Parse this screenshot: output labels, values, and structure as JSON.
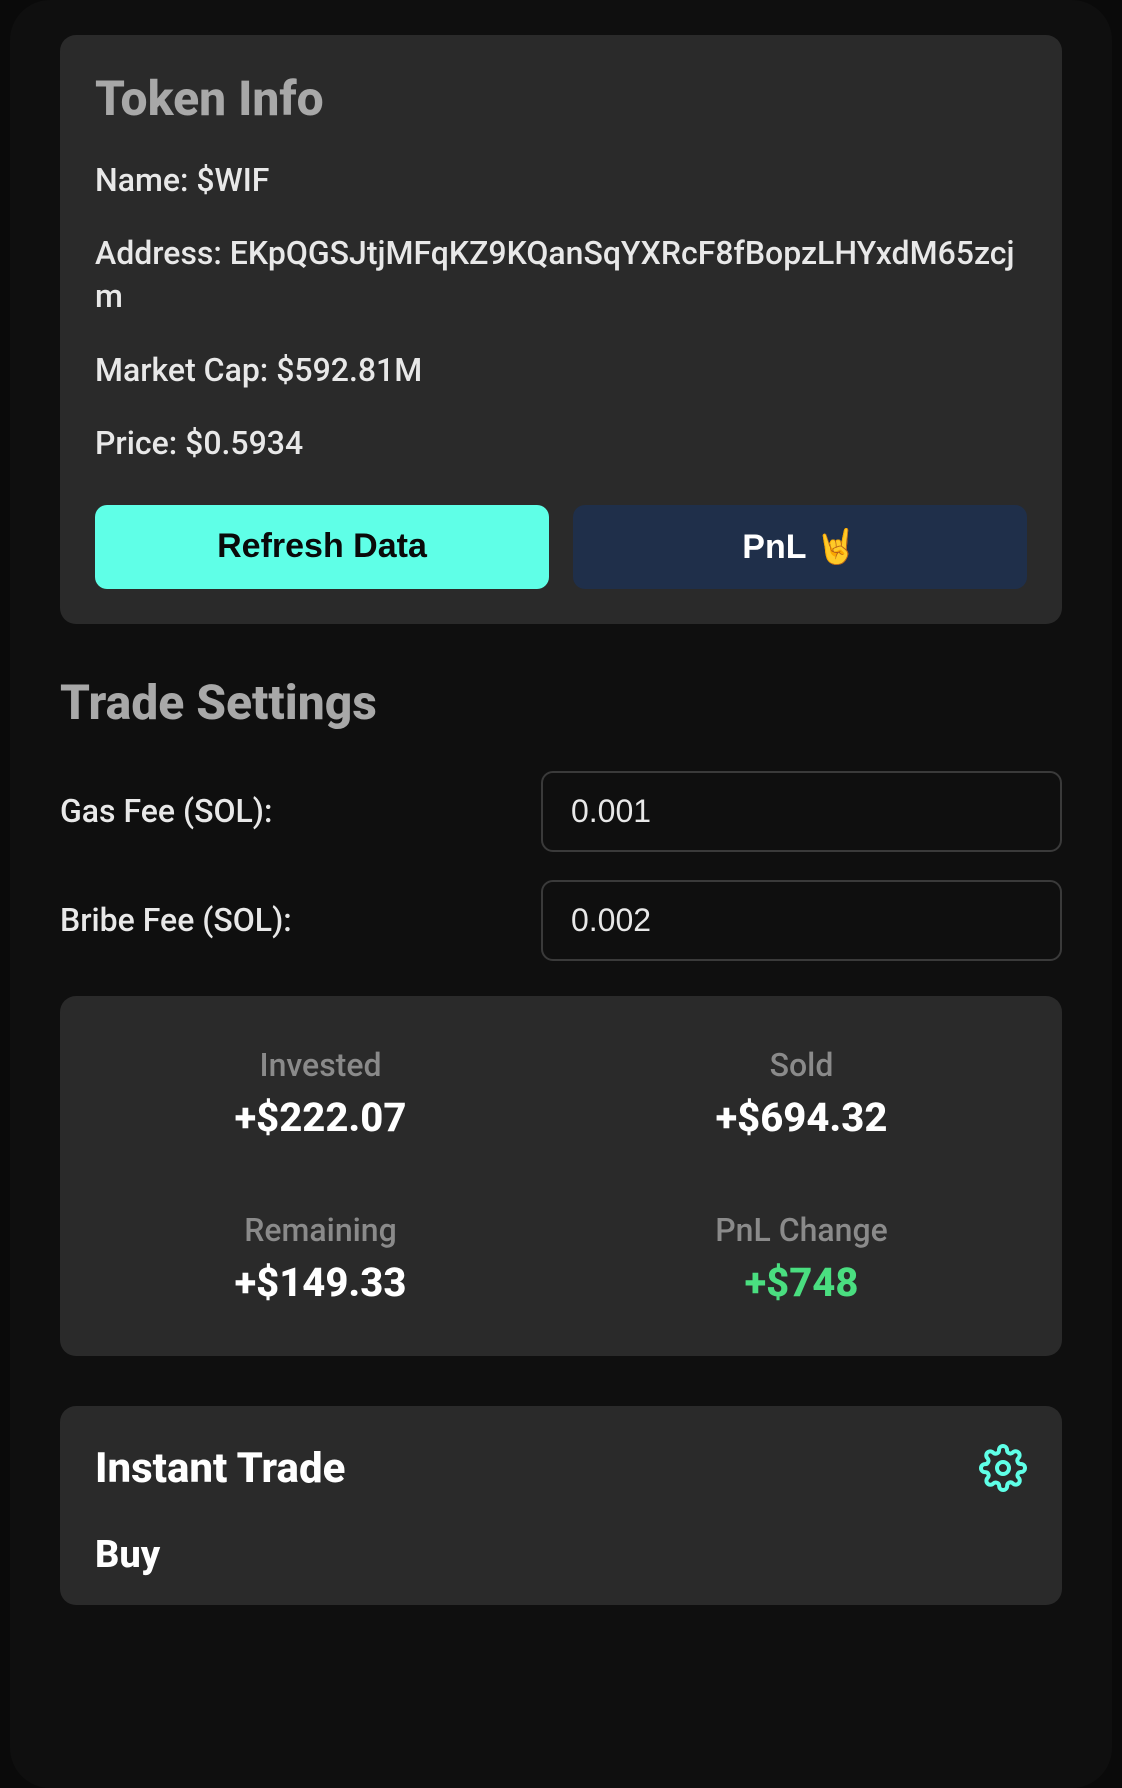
{
  "tokenInfo": {
    "title": "Token Info",
    "nameLabel": "Name:",
    "nameValue": "$WIF",
    "addressLabel": "Address:",
    "addressValue": "EKpQGSJtjMFqKZ9KQanSqYXRcF8fBopzLHYxdM65zcjm",
    "marketCapLabel": "Market Cap:",
    "marketCapValue": "$592.81M",
    "priceLabel": "Price:",
    "priceValue": "$0.5934",
    "refreshButton": "Refresh Data",
    "pnlButton": "PnL 🤘"
  },
  "tradeSettings": {
    "title": "Trade Settings",
    "gasFeeLabel": "Gas Fee (SOL):",
    "gasFeeValue": "0.001",
    "bribeFeeLabel": "Bribe Fee (SOL):",
    "bribeFeeValue": "0.002"
  },
  "stats": {
    "invested": {
      "label": "Invested",
      "value": "+$222.07"
    },
    "sold": {
      "label": "Sold",
      "value": "+$694.32"
    },
    "remaining": {
      "label": "Remaining",
      "value": "+$149.33"
    },
    "pnlChange": {
      "label": "PnL Change",
      "value": "+$748"
    }
  },
  "instantTrade": {
    "title": "Instant Trade",
    "buyLabel": "Buy"
  }
}
